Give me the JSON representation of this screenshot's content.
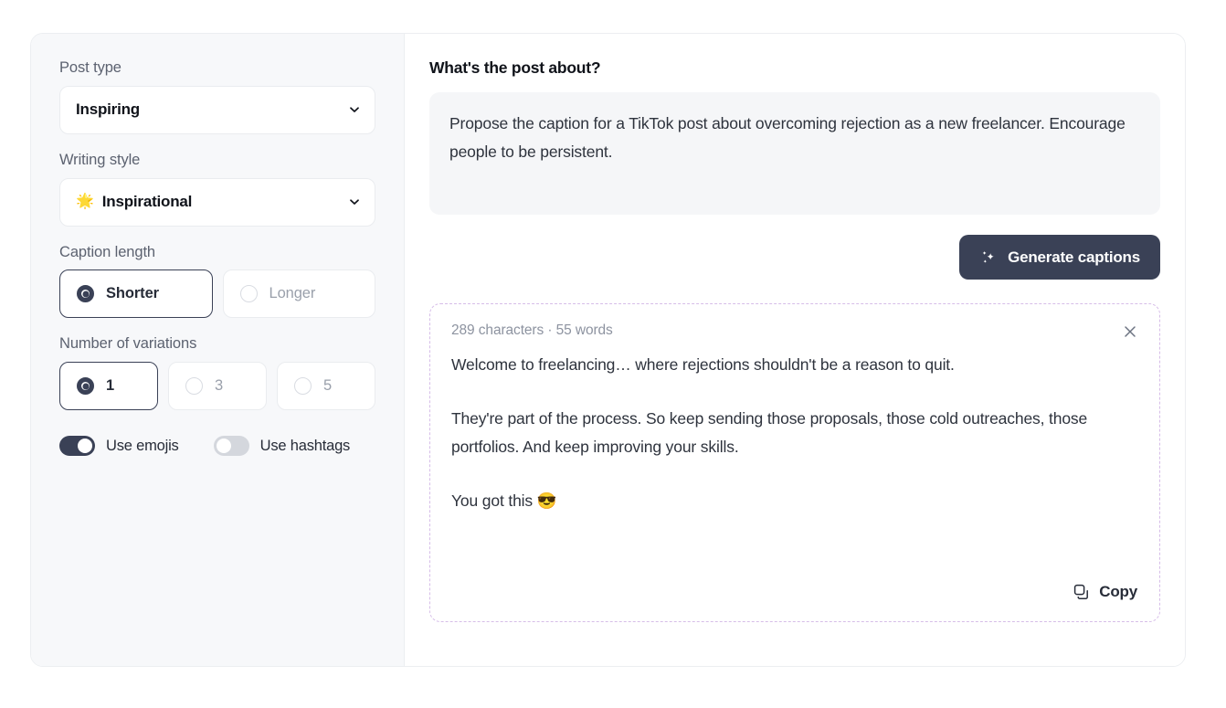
{
  "sidebar": {
    "post_type": {
      "label": "Post type",
      "value": "Inspiring",
      "icon": "chevron-down-icon"
    },
    "writing_style": {
      "label": "Writing style",
      "value": "Inspirational",
      "emoji": "🌟",
      "icon": "chevron-down-icon"
    },
    "caption_length": {
      "label": "Caption length",
      "options": [
        {
          "label": "Shorter",
          "selected": true
        },
        {
          "label": "Longer",
          "selected": false
        }
      ]
    },
    "number_of_variations": {
      "label": "Number of variations",
      "options": [
        {
          "label": "1",
          "selected": true
        },
        {
          "label": "3",
          "selected": false
        },
        {
          "label": "5",
          "selected": false
        }
      ]
    },
    "toggles": [
      {
        "label": "Use emojis",
        "on": true
      },
      {
        "label": "Use hashtags",
        "on": false
      }
    ]
  },
  "main": {
    "title": "What's the post about?",
    "prompt": {
      "value": "Propose the caption for a TikTok post about overcoming rejection as a new freelancer. Encourage people to be persistent.",
      "placeholder": "What's the post about?"
    },
    "generate_button": {
      "label": "Generate captions",
      "icon": "sparkles-icon"
    },
    "result": {
      "meta": "289 characters · 55 words",
      "close_icon": "close-icon",
      "paragraphs": [
        "Welcome to freelancing… where rejections shouldn't be a reason to quit.",
        "They're part of the process. So keep sending those proposals, those cold outreaches, those portfolios. And keep improving your skills.",
        "You got this 😎"
      ],
      "copy_button": {
        "label": "Copy",
        "icon": "copy-icon"
      }
    }
  },
  "colors": {
    "accent_dark": "#3a4156",
    "panel_bg": "#f7f8fa",
    "prompt_bg": "#f5f6f8",
    "result_border": "#d6bde8",
    "muted_text": "#8d93a0"
  }
}
